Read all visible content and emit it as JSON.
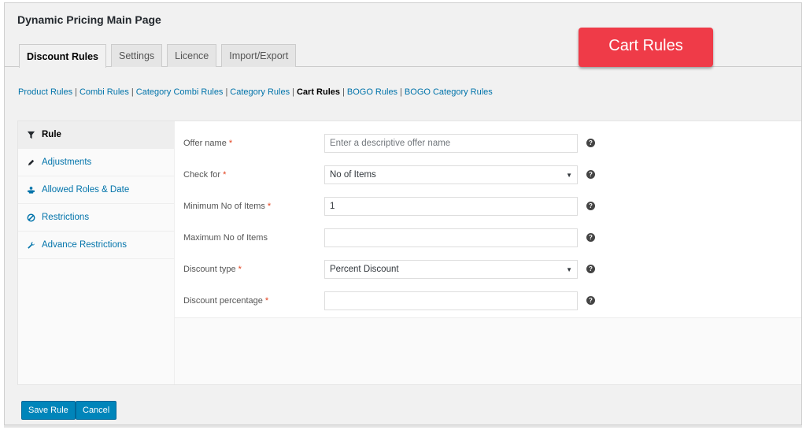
{
  "page": {
    "title": "Dynamic Pricing Main Page"
  },
  "tabs": [
    {
      "label": "Discount Rules",
      "active": true
    },
    {
      "label": "Settings",
      "active": false
    },
    {
      "label": "Licence",
      "active": false
    },
    {
      "label": "Import/Export",
      "active": false
    }
  ],
  "callout": {
    "label": "Cart Rules",
    "color": "#ef3b48"
  },
  "sublinks": [
    {
      "label": "Product Rules",
      "current": false
    },
    {
      "label": "Combi Rules",
      "current": false
    },
    {
      "label": "Category Combi Rules",
      "current": false
    },
    {
      "label": "Category Rules",
      "current": false
    },
    {
      "label": "Cart Rules",
      "current": true
    },
    {
      "label": "BOGO Rules",
      "current": false
    },
    {
      "label": "BOGO Category Rules",
      "current": false
    }
  ],
  "sublink_separator": "|",
  "sidebar": {
    "items": [
      {
        "label": "Rule",
        "icon": "filter-icon",
        "active": true
      },
      {
        "label": "Adjustments",
        "icon": "pencil-icon",
        "active": false
      },
      {
        "label": "Allowed Roles & Date",
        "icon": "users-icon",
        "active": false
      },
      {
        "label": "Restrictions",
        "icon": "ban-icon",
        "active": false
      },
      {
        "label": "Advance Restrictions",
        "icon": "wrench-icon",
        "active": false
      }
    ]
  },
  "form": {
    "required_marker": "*",
    "help_glyph": "?",
    "select_caret": "▼",
    "fields": [
      {
        "label": "Offer name",
        "required": true,
        "type": "text",
        "value": "",
        "placeholder": "Enter a descriptive offer name"
      },
      {
        "label": "Check for",
        "required": true,
        "type": "select",
        "value": "No of Items",
        "placeholder": ""
      },
      {
        "label": "Minimum No of Items",
        "required": true,
        "type": "text",
        "value": "1",
        "placeholder": ""
      },
      {
        "label": "Maximum No of Items",
        "required": false,
        "type": "text",
        "value": "",
        "placeholder": ""
      },
      {
        "label": "Discount type",
        "required": true,
        "type": "select",
        "value": "Percent Discount",
        "placeholder": ""
      },
      {
        "label": "Discount percentage",
        "required": true,
        "type": "text",
        "value": "",
        "placeholder": ""
      }
    ]
  },
  "actions": {
    "save_label": "Save Rule",
    "cancel_label": "Cancel"
  },
  "colors": {
    "primary_button": "#0085ba",
    "link": "#0073aa",
    "required": "#e2401c"
  }
}
